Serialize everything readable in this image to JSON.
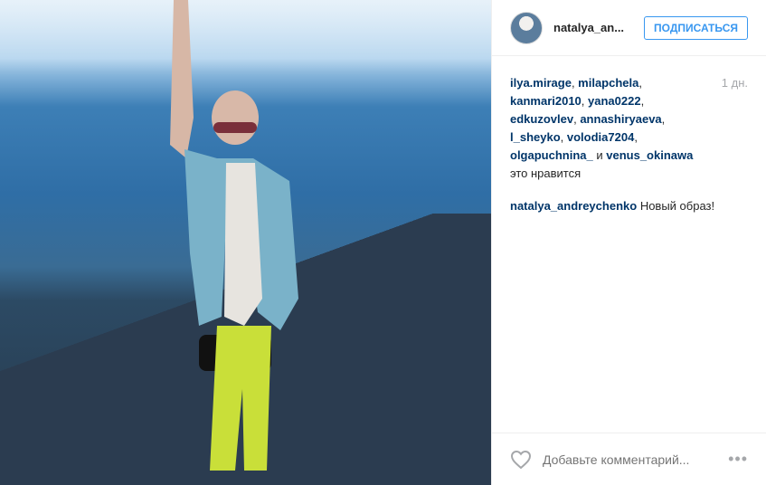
{
  "post": {
    "author": "natalya_an...",
    "follow_label": "ПОДПИСАТЬСЯ",
    "time_ago": "1 дн.",
    "likers": [
      "ilya.mirage",
      "milapchela",
      "kanmari2010",
      "yana0222",
      "edkuzovlev",
      "annashiryaeva",
      "l_sheyko",
      "volodia7204",
      "olgapuchnina_",
      "venus_okinawa"
    ],
    "likes_joiner_and": "и",
    "likes_suffix": "это нравится",
    "caption_author": "natalya_andreychenko",
    "caption_text": "Новый образ!",
    "comment_placeholder": "Добавьте комментарий...",
    "more_label": "•••"
  },
  "icons": {
    "like": "heart-outline-icon"
  },
  "colors": {
    "link": "#003569",
    "follow": "#3897f0",
    "muted": "#a5a7aa"
  }
}
